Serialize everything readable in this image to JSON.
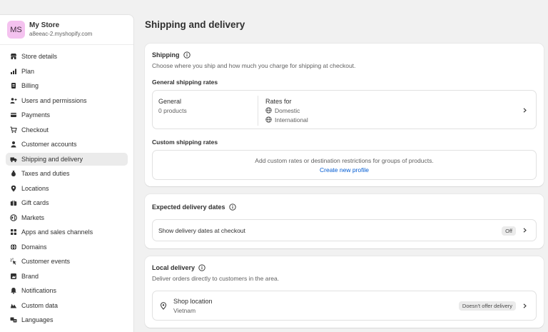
{
  "store": {
    "initials": "MS",
    "name": "My Store",
    "url": "a8eeac-2.myshopify.com"
  },
  "nav": [
    {
      "label": "Store details",
      "icon": "store-icon"
    },
    {
      "label": "Plan",
      "icon": "plan-icon"
    },
    {
      "label": "Billing",
      "icon": "billing-icon"
    },
    {
      "label": "Users and permissions",
      "icon": "users-icon"
    },
    {
      "label": "Payments",
      "icon": "payments-icon"
    },
    {
      "label": "Checkout",
      "icon": "cart-icon"
    },
    {
      "label": "Customer accounts",
      "icon": "person-icon"
    },
    {
      "label": "Shipping and delivery",
      "icon": "truck-icon"
    },
    {
      "label": "Taxes and duties",
      "icon": "tax-icon"
    },
    {
      "label": "Locations",
      "icon": "location-pin-icon"
    },
    {
      "label": "Gift cards",
      "icon": "gift-card-icon"
    },
    {
      "label": "Markets",
      "icon": "globe-icon"
    },
    {
      "label": "Apps and sales channels",
      "icon": "apps-icon"
    },
    {
      "label": "Domains",
      "icon": "domain-globe-icon"
    },
    {
      "label": "Customer events",
      "icon": "events-icon"
    },
    {
      "label": "Brand",
      "icon": "brand-icon"
    },
    {
      "label": "Notifications",
      "icon": "bell-icon"
    },
    {
      "label": "Custom data",
      "icon": "custom-data-icon"
    },
    {
      "label": "Languages",
      "icon": "languages-icon"
    }
  ],
  "active_nav": "Shipping and delivery",
  "page_title": "Shipping and delivery",
  "shipping": {
    "title": "Shipping",
    "description": "Choose where you ship and how much you charge for shipping at checkout.",
    "general_rates_heading": "General shipping rates",
    "general_profile": {
      "name": "General",
      "products": "0 products",
      "rates_for_label": "Rates for",
      "zones": [
        "Domestic",
        "International"
      ]
    },
    "custom_rates_heading": "Custom shipping rates",
    "custom_rates_text": "Add custom rates or destination restrictions for groups of products.",
    "create_profile_link": "Create new profile"
  },
  "expected_delivery": {
    "title": "Expected delivery dates",
    "row_label": "Show delivery dates at checkout",
    "status": "Off"
  },
  "local_delivery": {
    "title": "Local delivery",
    "description": "Deliver orders directly to customers in the area.",
    "location_name": "Shop location",
    "location_country": "Vietnam",
    "status": "Doesn't offer delivery"
  }
}
